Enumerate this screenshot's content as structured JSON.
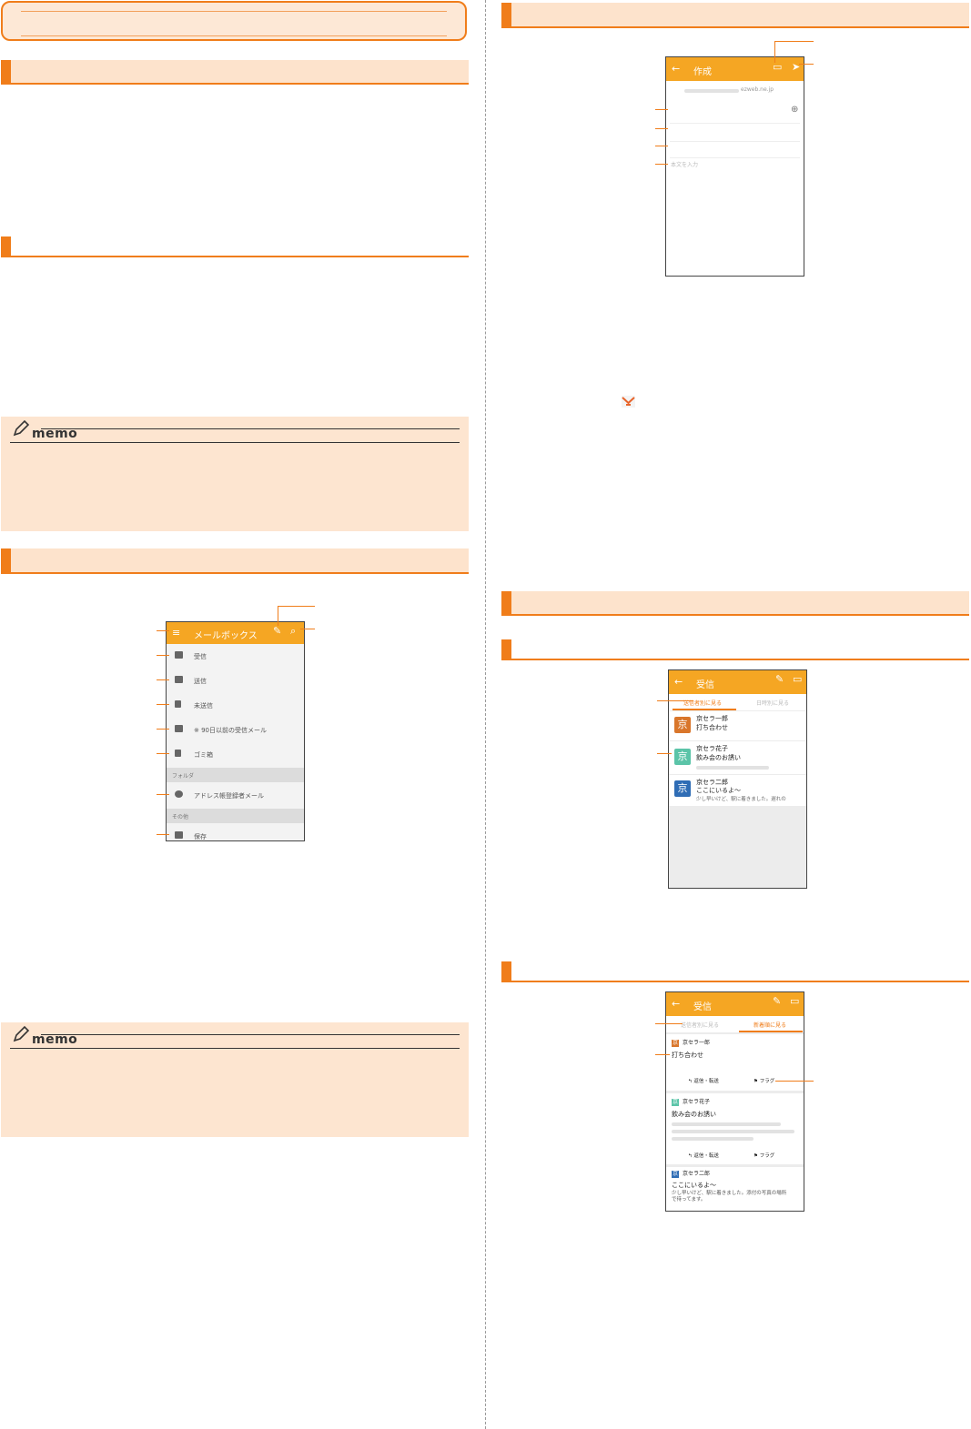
{
  "compose_screen": {
    "title": "作成",
    "from_domain": "ezweb.ne.jp",
    "body_placeholder": "本文を入力"
  },
  "folder_screen": {
    "title": "メールボックス",
    "folders": [
      "受信",
      "送信",
      "未送信",
      "※ 90日以前の受信メール",
      "ゴミ箱"
    ],
    "group_folder": "フォルダ",
    "address_folder": "アドレス帳登録者メール",
    "group_other": "その他",
    "other_folder": "保存"
  },
  "inbox_by_sender": {
    "title": "受信",
    "tab_active": "送信者別に見る",
    "tab_inactive": "日時別に見る",
    "items": [
      {
        "avatar": "京",
        "color": "#d9762b",
        "sender": "京セラ一郎",
        "subject": "打ち合わせ",
        "preview": ""
      },
      {
        "avatar": "京",
        "color": "#5bc4a8",
        "sender": "京セラ花子",
        "subject": "飲み会のお誘い",
        "preview": ""
      },
      {
        "avatar": "京",
        "color": "#2f6db5",
        "sender": "京セラ二郎",
        "subject": "ここにいるよ～",
        "preview": "少し早いけど、駅に着きました。遅れの"
      }
    ]
  },
  "inbox_by_date": {
    "title": "受信",
    "tab_inactive": "送信者別に見る",
    "tab_active": "新着順に見る",
    "items": [
      {
        "avatar": "京",
        "color": "#d9762b",
        "sender": "京セラ一郎",
        "subject": "打ち合わせ",
        "body": "",
        "reply": "返信・転送",
        "flag": "フラグ"
      },
      {
        "avatar": "京",
        "color": "#5bc4a8",
        "sender": "京セラ花子",
        "subject": "飲み会のお誘い",
        "body": "",
        "reply": "返信・転送",
        "flag": "フラグ"
      },
      {
        "avatar": "京",
        "color": "#2f6db5",
        "sender": "京セラ二郎",
        "subject": "ここにいるよ～",
        "body": "少し早いけど、駅に着きました。添付の写真の場所で待ってます。",
        "reply": "",
        "flag": ""
      }
    ]
  },
  "memo_label": "memo",
  "colors": {
    "accent": "#f07d1a",
    "appbar": "#f5a623",
    "band": "#fde3cc"
  },
  "icons": [
    "pencil-icon",
    "search-icon",
    "send-icon",
    "envelope-icon",
    "add-icon"
  ]
}
